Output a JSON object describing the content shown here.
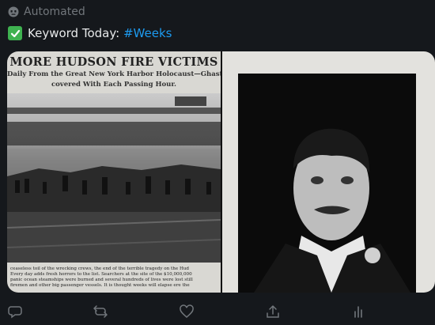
{
  "header": {
    "automated_label": "Automated",
    "keyword_prefix": "Keyword Today:",
    "keyword_hashtag": "#Weeks"
  },
  "media": {
    "clipping": {
      "headline": "MORE HUDSON FIRE VICTIMS",
      "subhead_line1": "Daily From the Great New York Harbor Holocaust—Ghastly",
      "subhead_line2": "covered With Each Passing Hour.",
      "caption_lines": [
        "ceaseless toil of the wrecking crews, the end of the terrible tragedy on the Hud",
        "Every day adds fresh horrors to the list. Searchers at the site of the $10,000,000",
        "panic ocean steamships were burned and several hundreds of lives were lost still",
        "firemen and other big passenger vessels. It is thought weeks will elapse ere the"
      ]
    }
  },
  "actions": {
    "icons": [
      "reply-icon",
      "retweet-icon",
      "like-icon",
      "share-icon",
      "analytics-icon"
    ]
  },
  "colors": {
    "background": "#15181c",
    "text_primary": "#e7e9ea",
    "text_secondary": "#71767b",
    "link": "#1d9bf0",
    "check_green": "#3eb250"
  }
}
